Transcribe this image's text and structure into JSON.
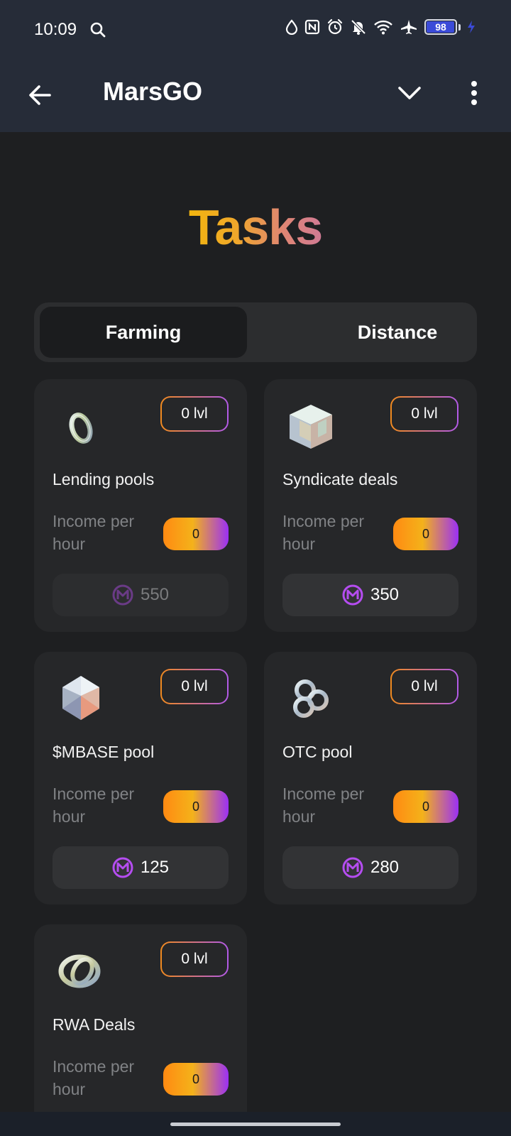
{
  "status_bar": {
    "time": "10:09",
    "battery_level": "98",
    "battery_fraction": 0.98,
    "icons": [
      "search-icon",
      "water-drop-icon",
      "nfc-icon",
      "alarm-icon",
      "bell-off-icon",
      "wifi-icon",
      "airplane-icon",
      "battery-icon",
      "charging-bolt-icon"
    ]
  },
  "app_bar": {
    "title": "MarsGO",
    "icons": [
      "back-arrow-icon",
      "chevron-down-icon",
      "more-vertical-icon"
    ]
  },
  "page": {
    "title": "Tasks",
    "title_gradient": [
      "#f2b50f",
      "#d07a95"
    ]
  },
  "tabs": [
    {
      "label": "Farming",
      "active": true
    },
    {
      "label": "Distance",
      "active": false
    }
  ],
  "cards": [
    {
      "title": "Lending pools",
      "level": "0 lvl",
      "income_label": "Income per hour",
      "income_value": "0",
      "price": "550",
      "icon": "ring-icon"
    },
    {
      "title": "Syndicate deals",
      "level": "0 lvl",
      "income_label": "Income per hour",
      "income_value": "0",
      "price": "350",
      "icon": "cube-icon"
    },
    {
      "title": "$MBASE pool",
      "level": "0 lvl",
      "income_label": "Income per hour",
      "income_value": "0",
      "price": "125",
      "icon": "icosahedron-icon"
    },
    {
      "title": "OTC pool",
      "level": "0 lvl",
      "income_label": "Income per hour",
      "income_value": "0",
      "price": "280",
      "icon": "trefoil-icon"
    },
    {
      "title": "RWA Deals",
      "level": "0 lvl",
      "income_label": "Income per hour",
      "income_value": "0",
      "icon": "knot-icon"
    }
  ],
  "colors": {
    "background": "#1e1f21",
    "card": "#262729",
    "header": "#262c38",
    "accent_orange": "#f08a1e",
    "accent_purple": "#9b30f5"
  }
}
